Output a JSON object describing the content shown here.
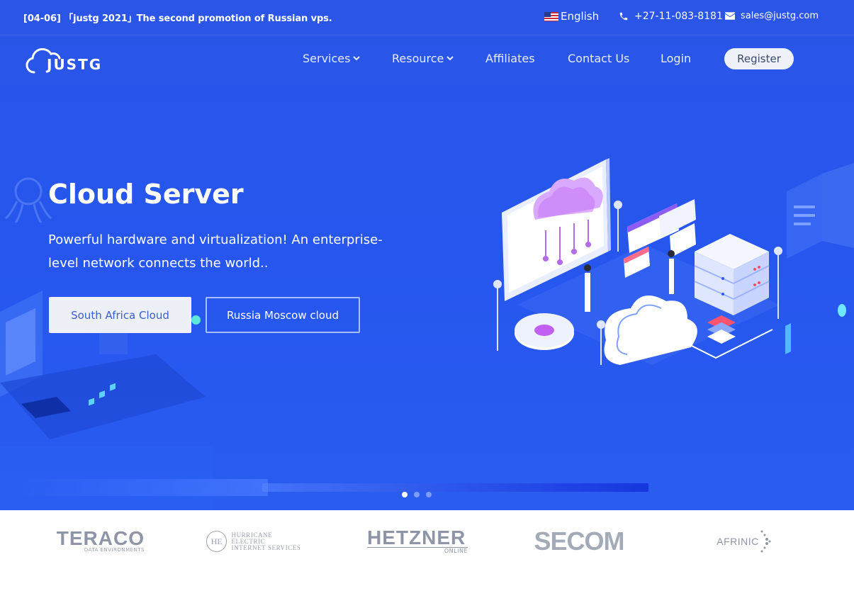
{
  "topbar": {
    "announcement": "[04-06] 「justg 2021」The second promotion of Russian vps.",
    "language": "English",
    "phone": "+27-11-083-8181",
    "email": "sales@justg.com"
  },
  "brand": {
    "logo_text": "JUSTG"
  },
  "nav": {
    "items": [
      {
        "label": "Services"
      },
      {
        "label": "Resource"
      },
      {
        "label": "Affiliates"
      },
      {
        "label": "Contact Us"
      },
      {
        "label": "Login"
      }
    ],
    "register": "Register"
  },
  "hero": {
    "title": "Cloud Server",
    "subtitle": "Powerful hardware and virtualization! An enterprise-level network connects the world..",
    "primary_button": "South Africa Cloud",
    "secondary_button": "Russia Moscow cloud",
    "slides_total": 3,
    "slide_active": 1
  },
  "partners": {
    "teraco": {
      "name": "TERACO",
      "tagline": "DATA ENVIRONMENTS"
    },
    "he": {
      "mark": "HE",
      "line1": "HURRICANE ELECTRIC",
      "line2": "INTERNET SERVICES"
    },
    "hetzner": {
      "name": "HETZNER",
      "tagline": "ONLINE"
    },
    "secom": {
      "name": "SECOM"
    },
    "afrinic": {
      "name": "AFRINIC"
    }
  },
  "colors": {
    "hero_bg": "#2656ee",
    "accent": "#ffffff",
    "partner_gray": "#8d95a6"
  },
  "icons": [
    "us-flag-icon",
    "phone-icon",
    "mail-icon",
    "chevron-down-icon",
    "cloud-logo-icon"
  ]
}
